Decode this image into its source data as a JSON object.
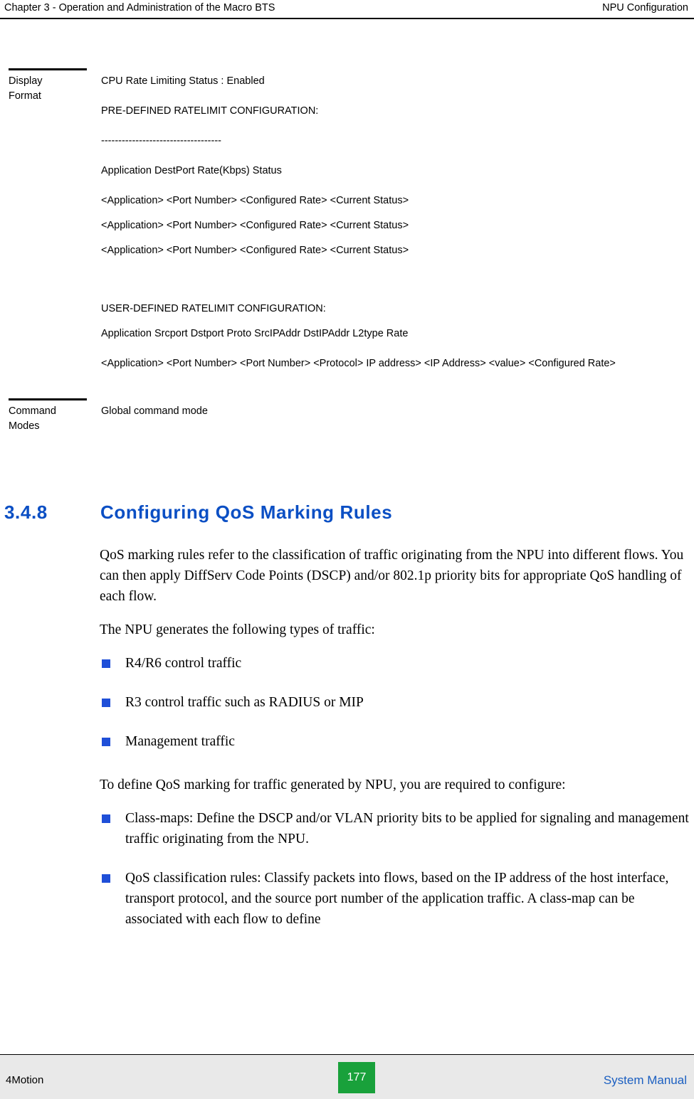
{
  "header": {
    "left": "Chapter 3 - Operation and Administration of the Macro BTS",
    "right": "NPU Configuration"
  },
  "param_table": {
    "rows": [
      {
        "label_line1": "Display",
        "label_line2": "Format",
        "lines": [
          "CPU Rate Limiting Status : Enabled",
          "PRE-DEFINED RATELIMIT CONFIGURATION:",
          "-----------------------------------",
          "Application   DestPort      Rate(Kbps)     Status",
          "<Application>  <Port Number>  <Configured Rate> <Current Status>",
          "<Application>  <Port Number>  <Configured Rate> <Current Status>",
          "<Application>  <Port Number>  <Configured Rate> <Current Status>",
          "USER-DEFINED RATELIMIT CONFIGURATION:",
          "Application  Srcport    Dstport     Proto       SrcIPAddr   DstIPAddr   L2type    Rate",
          "<Application> <Port Number> <Port Number>  <Protocol>    IP address> <IP Address>   <value> <Configured Rate>"
        ]
      },
      {
        "label_line1": "Command",
        "label_line2": "Modes",
        "lines": [
          "Global command mode"
        ]
      }
    ]
  },
  "section": {
    "number": "3.4.8",
    "title": "Configuring QoS Marking Rules"
  },
  "body": {
    "paragraph1": "QoS marking rules refer to the classification of traffic originating from the NPU into different flows. You can then apply DiffServ Code Points (DSCP) and/or 802.1p priority bits for appropriate QoS handling of each flow.",
    "paragraph2": "The NPU generates the following types of traffic:",
    "list1": [
      "R4/R6 control traffic",
      "R3 control traffic such as RADIUS or MIP",
      "Management traffic"
    ],
    "paragraph3": "To define QoS marking for traffic generated by NPU, you are required to configure:",
    "list2": [
      "Class-maps: Define the DSCP and/or VLAN priority bits to be applied for signaling and management traffic originating from the NPU.",
      "QoS classification rules: Classify packets into flows, based on the IP address of the host interface, transport protocol, and the source port number of the application traffic. A class-map can be associated with each flow to define"
    ]
  },
  "footer": {
    "left": "4Motion",
    "page": "177",
    "right": "System Manual"
  }
}
